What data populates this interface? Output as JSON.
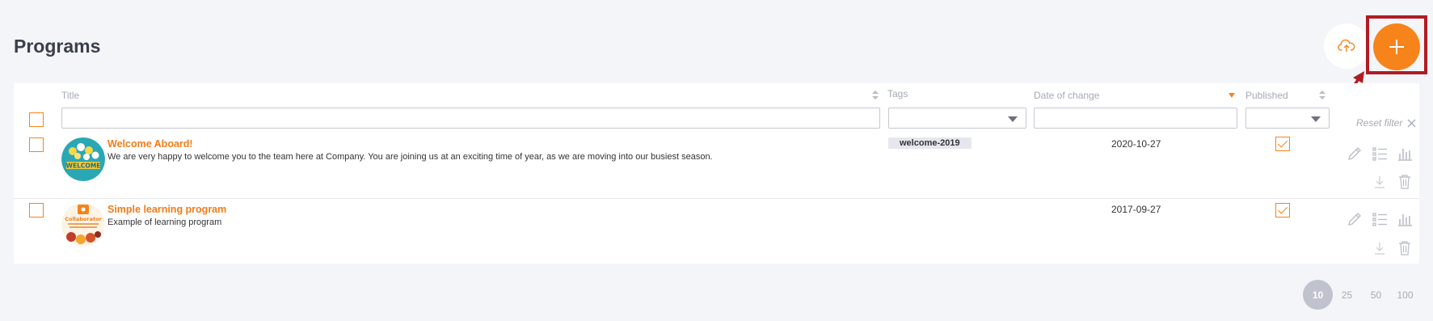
{
  "page": {
    "title": "Programs"
  },
  "toolbar": {
    "upload_icon": "cloud-upload-icon",
    "add_icon": "plus-icon"
  },
  "table": {
    "columns": {
      "title": "Title",
      "tags": "Tags",
      "date": "Date of change",
      "published": "Published"
    },
    "filters": {
      "title_value": "",
      "tags_value": "",
      "date_value": "",
      "published_value": ""
    },
    "reset_filter": "Reset filter",
    "rows": [
      {
        "title": "Welcome Aboard!",
        "description": "We are very happy to welcome you to the team here at Company. You are joining us at an exciting time of year, as we are moving into our busiest season.",
        "tag": "welcome-2019",
        "date": "2020-10-27",
        "published": true,
        "thumb_text": "WELCOME"
      },
      {
        "title": "Simple learning program",
        "description": "Example of learning program",
        "tag": "",
        "date": "2017-09-27",
        "published": true,
        "thumb_text": "Collaborator"
      }
    ]
  },
  "pagination": {
    "sizes": [
      "10",
      "25",
      "50",
      "100"
    ],
    "active": "10"
  },
  "colors": {
    "accent": "#f7841a",
    "highlight": "#b01c22",
    "background": "#f4f5f9"
  }
}
